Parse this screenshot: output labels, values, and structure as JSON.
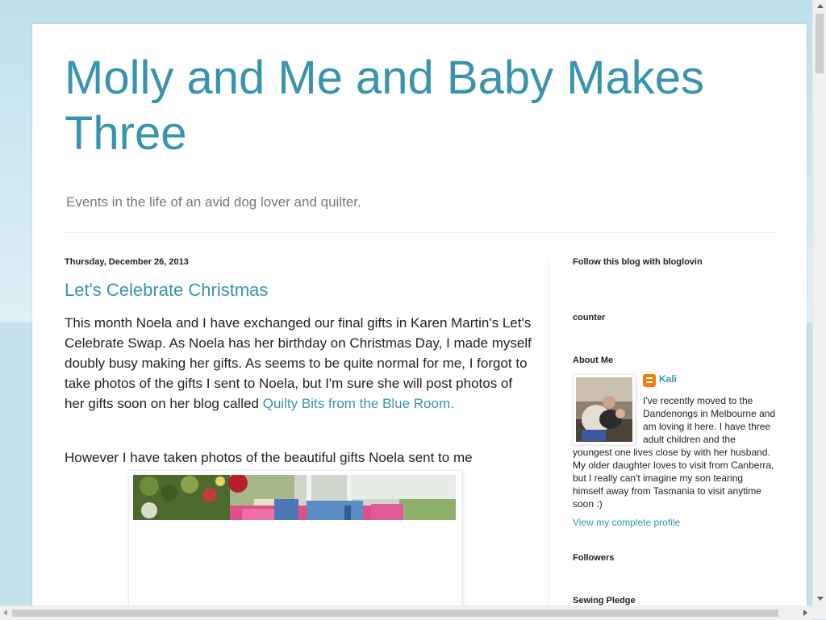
{
  "header": {
    "title": "Molly and Me and Baby Makes Three",
    "description": "Events in the life of an avid dog lover and quilter."
  },
  "post": {
    "date": "Thursday, December 26, 2013",
    "title": "Let's Celebrate Christmas",
    "body_text": "This month Noela and I have exchanged our final gifts in Karen Martin's Let's Celebrate Swap.  As Noela has her birthday on Christmas Day, I made myself doubly busy making her gifts.  As seems to be quite normal for me, I forgot to take photos of the gifts I sent to Noela, but I'm sure she will post photos of her gifts soon on her blog called ",
    "link_text": "Quilty Bits from the Blue Room.",
    "second_paragraph": "However I have taken photos of the beautiful gifts Noela sent to me"
  },
  "sidebar": {
    "bloglovin_heading": "Follow this blog with bloglovin",
    "counter_heading": "counter",
    "about_heading": "About Me",
    "profile_name": "Kali",
    "profile_about": "I've recently moved to the Dandenongs in Melbourne and am loving it here. I have three adult children and the youngest one lives close by with her husband. My older daughter loves to visit from Canberra, but I really can't imagine my son tearing himself away from Tasmania to visit anytime soon :)",
    "view_profile": "View my complete profile",
    "followers_heading": "Followers",
    "sewing_pledge_heading": "Sewing Pledge"
  },
  "colors": {
    "link": "#3894ae",
    "background": "#c9e4ee",
    "text": "#222222"
  }
}
